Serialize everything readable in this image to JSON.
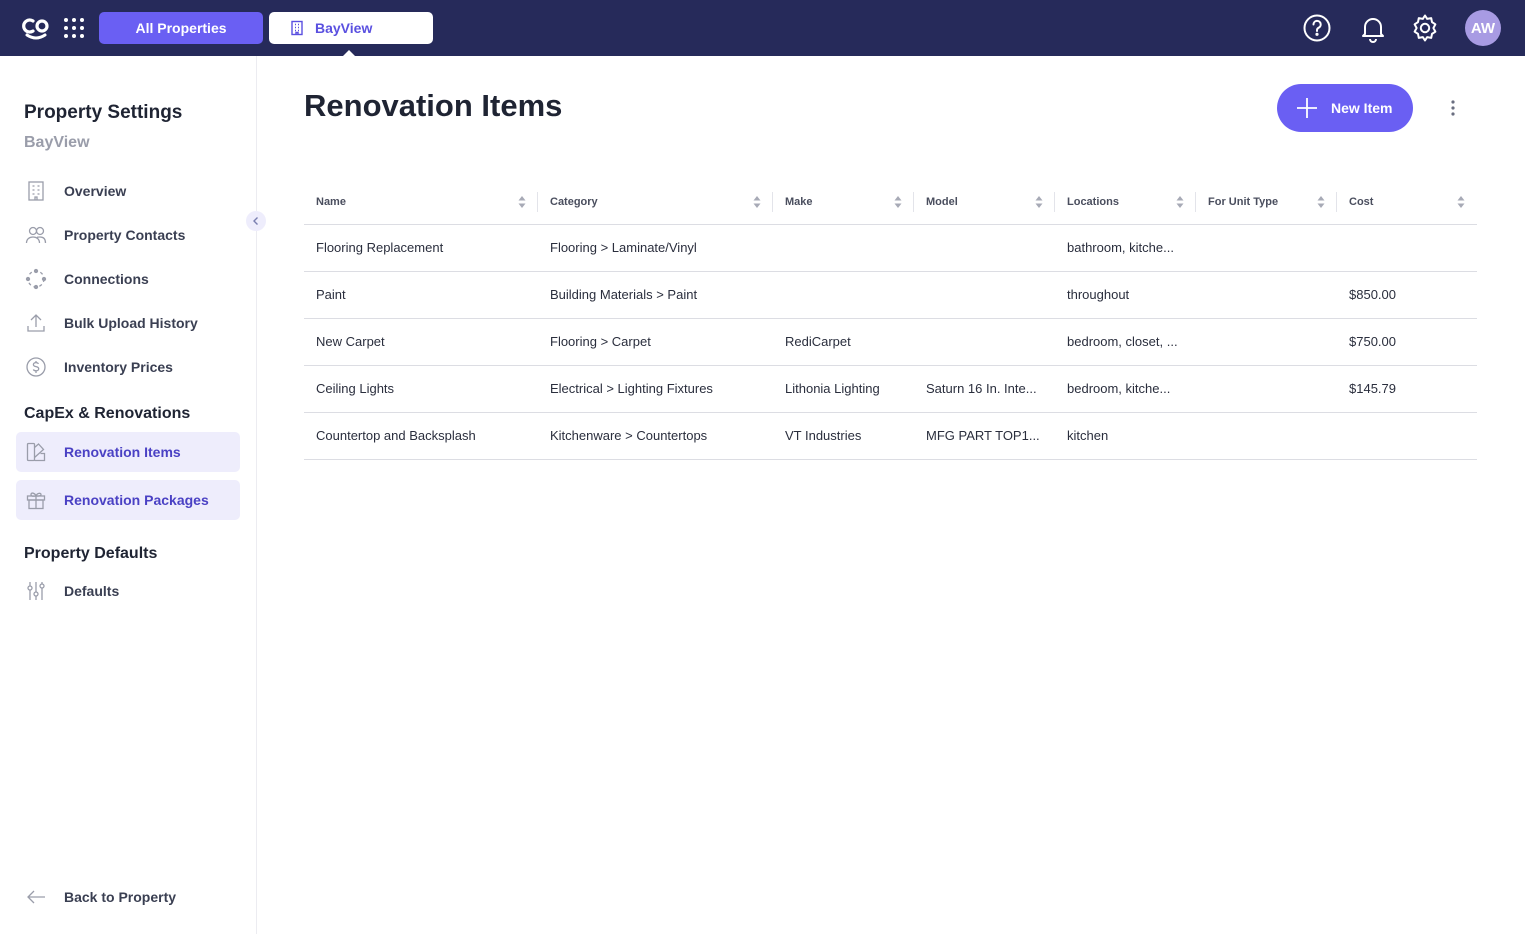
{
  "topbar": {
    "logo_icon": "co-logo-icon",
    "apps_icon": "grid-dots-icon",
    "tab_all": "All Properties",
    "tab_property": "BayView",
    "help_icon": "help-circle-icon",
    "bell_icon": "bell-icon",
    "settings_icon": "gear-icon",
    "avatar_initials": "AW",
    "accent": "#6a5ff3",
    "bar_color": "#262a5a"
  },
  "sidebar": {
    "title": "Property Settings",
    "subtitle": "BayView",
    "items": [
      {
        "label": "Overview",
        "icon": "building-icon"
      },
      {
        "label": "Property Contacts",
        "icon": "contacts-icon"
      },
      {
        "label": "Connections",
        "icon": "connections-icon"
      },
      {
        "label": "Bulk Upload History",
        "icon": "upload-icon"
      },
      {
        "label": "Inventory Prices",
        "icon": "dollar-icon"
      }
    ],
    "section_capex": "CapEx & Renovations",
    "capex_items": [
      {
        "label": "Renovation Items",
        "icon": "swatch-icon"
      },
      {
        "label": "Renovation Packages",
        "icon": "gift-icon"
      }
    ],
    "section_defaults": "Property Defaults",
    "defaults_items": [
      {
        "label": "Defaults",
        "icon": "sliders-icon"
      }
    ],
    "back_label": "Back to Property"
  },
  "main": {
    "title": "Renovation Items",
    "new_button": "New Item"
  },
  "table": {
    "columns": [
      "Name",
      "Category",
      "Make",
      "Model",
      "Locations",
      "For Unit Type",
      "Cost"
    ],
    "rows": [
      [
        "Flooring Replacement",
        "Flooring > Laminate/Vinyl",
        "",
        "",
        "bathroom, kitche...",
        "",
        ""
      ],
      [
        "Paint",
        "Building Materials > Paint",
        "",
        "",
        "throughout",
        "",
        "$850.00"
      ],
      [
        "New Carpet",
        "Flooring > Carpet",
        "RediCarpet",
        "",
        "bedroom, closet, ...",
        "",
        "$750.00"
      ],
      [
        "Ceiling Lights",
        "Electrical > Lighting Fixtures",
        "Lithonia Lighting",
        "Saturn 16 In. Inte...",
        "bedroom, kitche...",
        "",
        "$145.79"
      ],
      [
        "Countertop and Backsplash",
        "Kitchenware > Countertops",
        "VT Industries",
        "MFG PART TOP1...",
        "kitchen",
        "",
        ""
      ]
    ]
  }
}
